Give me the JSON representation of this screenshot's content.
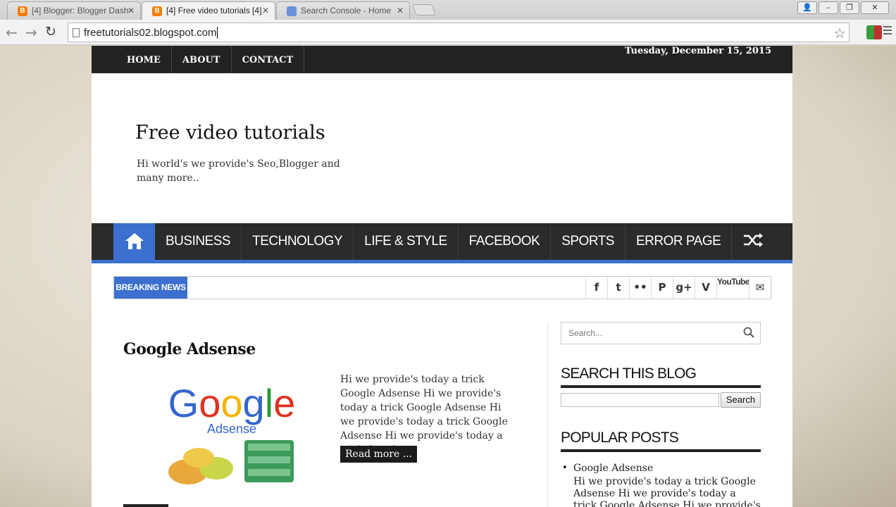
{
  "browser": {
    "tabs": [
      {
        "label": "[4] Blogger: Blogger Dash",
        "active": false
      },
      {
        "label": "[4] Free video tutorials [4]",
        "active": true
      },
      {
        "label": "Search Console - Home",
        "active": false
      }
    ],
    "url": "freetutorials02.blogspot.com"
  },
  "topbar": {
    "nav": [
      "HOME",
      "ABOUT",
      "CONTACT"
    ],
    "date": "Tuesday, December 15, 2015"
  },
  "header": {
    "title": "Free video tutorials",
    "description": "Hi world's we provide's Seo,Blogger and many more.."
  },
  "mainnav": {
    "items": [
      "BUSINESS",
      "TECHNOLOGY",
      "LIFE & STYLE",
      "FACEBOOK",
      "SPORTS",
      "ERROR PAGE"
    ]
  },
  "breaking": {
    "label": "BREAKING NEWS",
    "social": [
      "f",
      "t",
      "••",
      "P",
      "g+",
      "V",
      "YouTube",
      "✉"
    ]
  },
  "post": {
    "title": "Google Adsense",
    "thumb_brand": "Google",
    "thumb_sub": "Adsense",
    "excerpt": "Hi we provide's today a trick Google Adsense Hi we provide's today a trick Google Adsense Hi we provide's today a trick Google Adsense Hi we provide's today a trick Google...",
    "read_more": "Read more ..."
  },
  "sidebar": {
    "search_placeholder": "Search...",
    "search_blog_title": "SEARCH THIS BLOG",
    "search_button": "Search",
    "popular_title": "POPULAR POSTS",
    "popular": [
      {
        "title": "Google Adsense",
        "excerpt": "Hi we provide's today a trick Google Adsense   Hi we provide's today a trick Google Adsense  Hi we provide's today a"
      }
    ]
  },
  "colors": {
    "accent": "#3b6fd0",
    "dark": "#222222"
  }
}
